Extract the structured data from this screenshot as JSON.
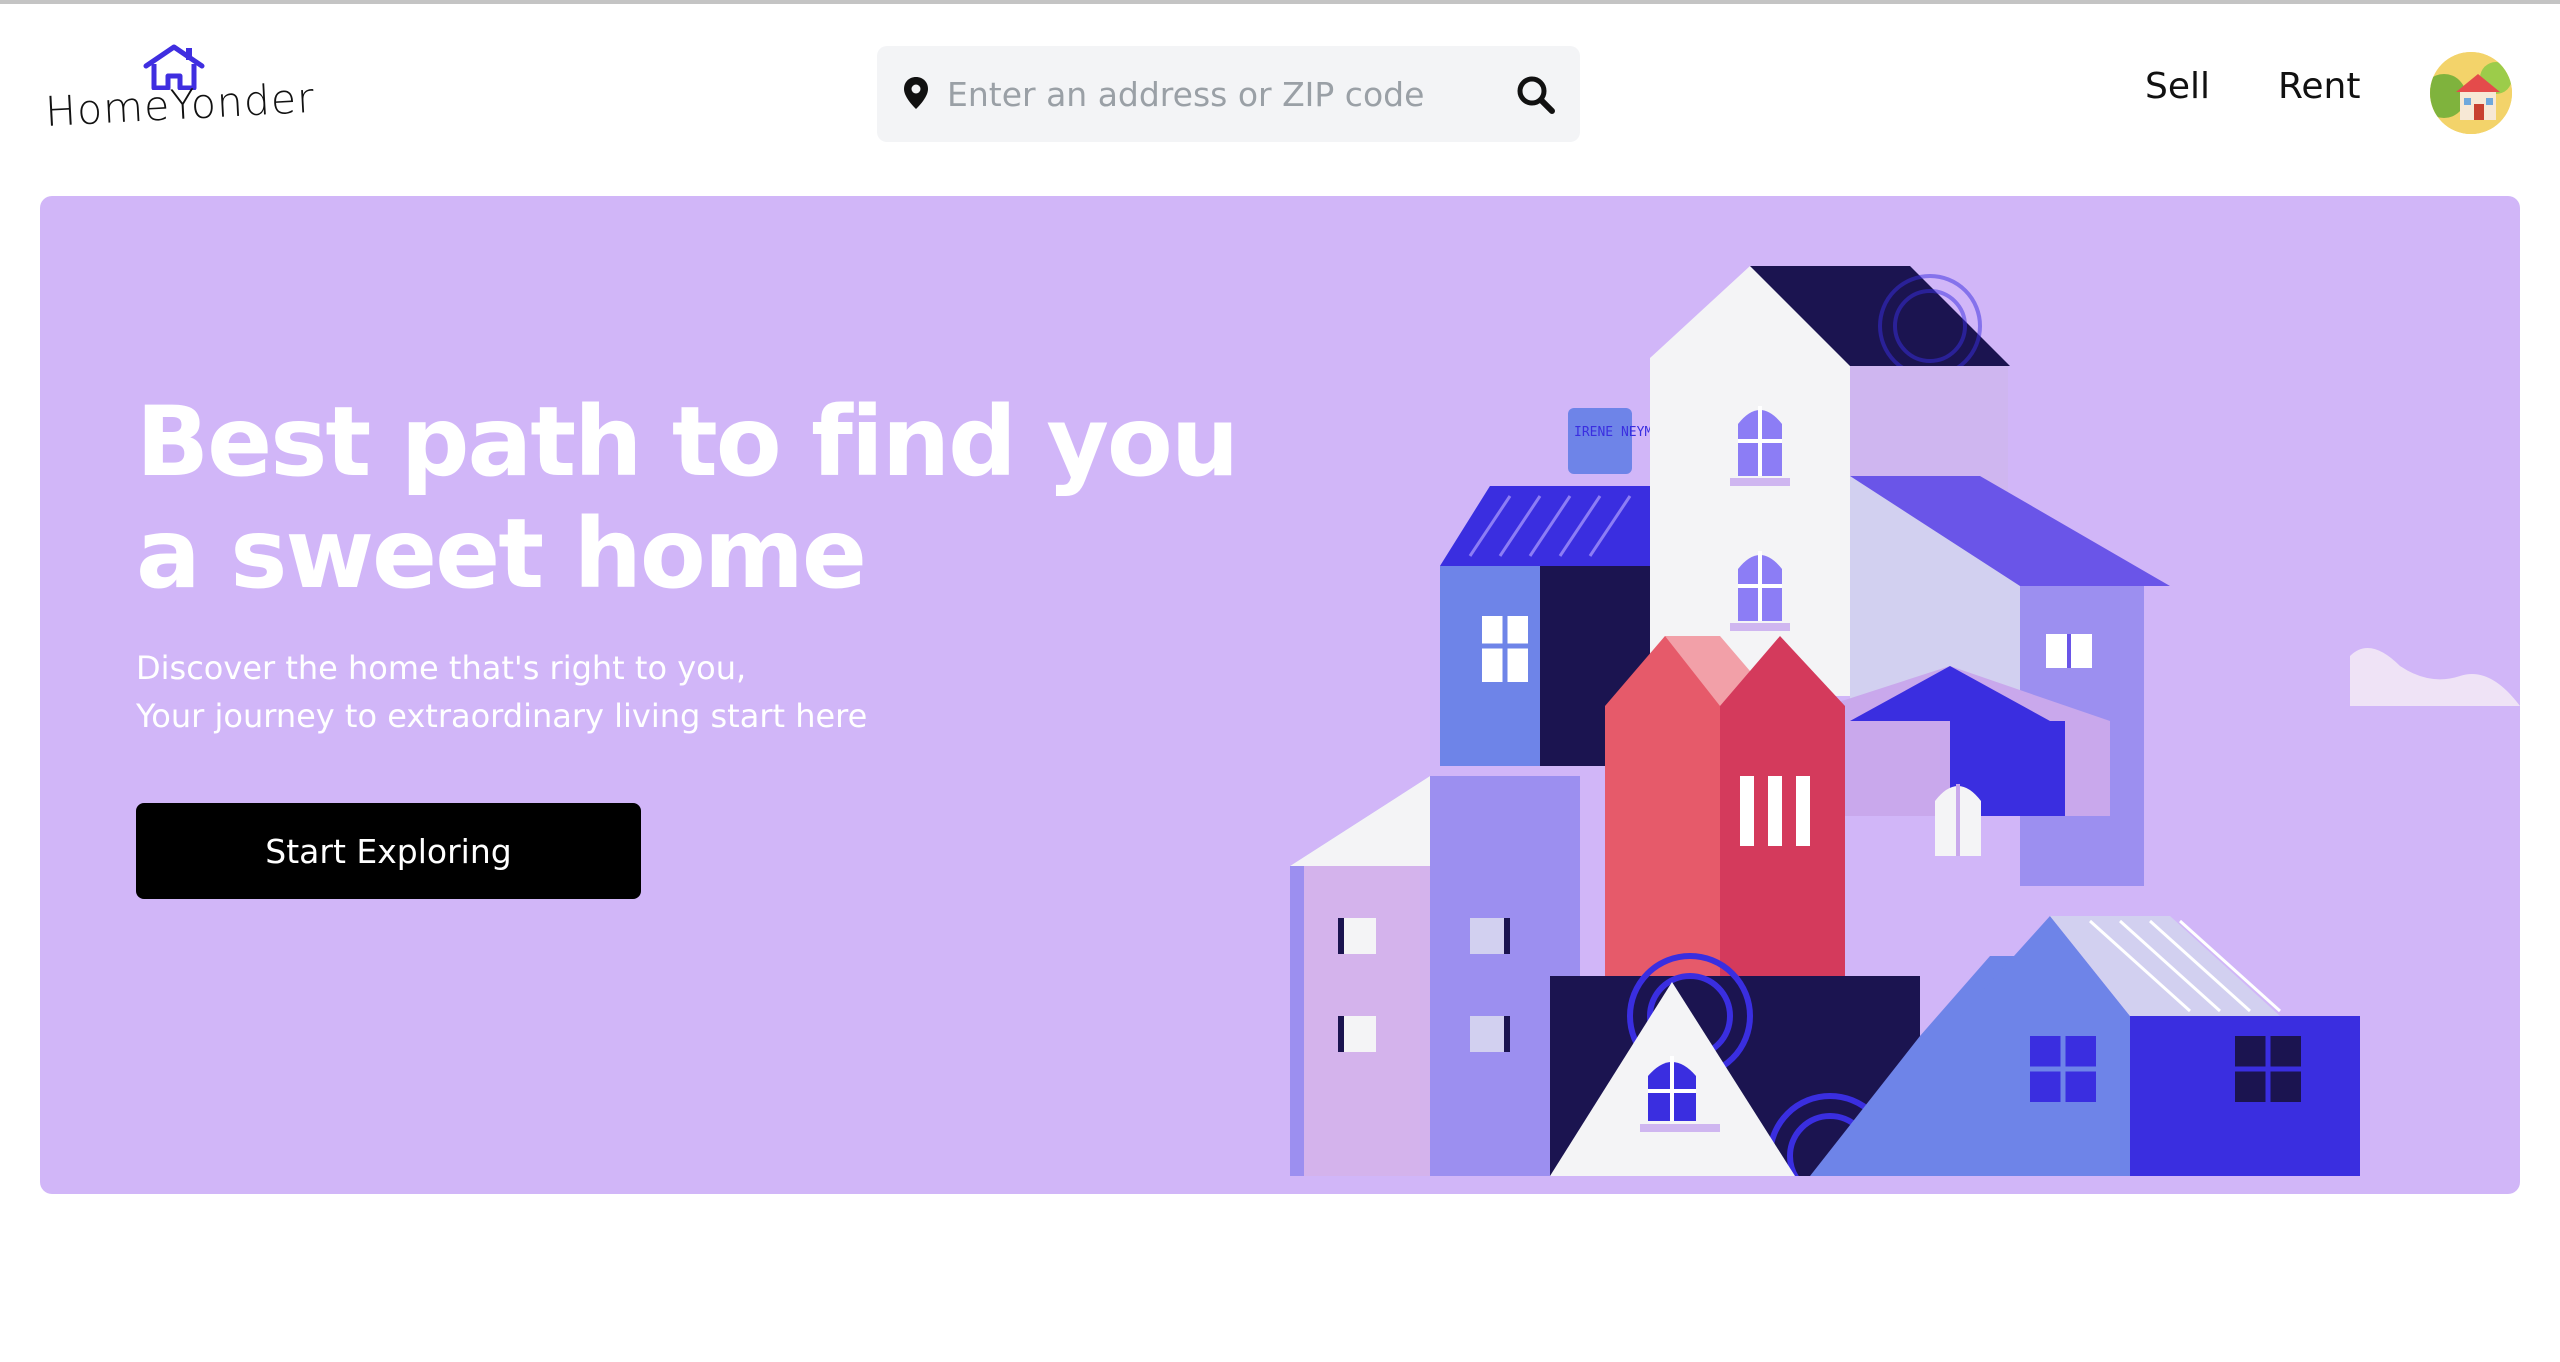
{
  "header": {
    "logo_text": "HomeYonder",
    "search": {
      "placeholder": "Enter an address or ZIP code",
      "value": ""
    },
    "nav": {
      "sell_label": "Sell",
      "rent_label": "Rent"
    }
  },
  "hero": {
    "title_line1": "Best path to find you",
    "title_line2": "a sweet home",
    "subtitle_line1": "Discover the home that's right to you,",
    "subtitle_line2": "Your journey to extraordinary living start here",
    "cta_label": "Start Exploring",
    "illustration_signature": "IRENE NEYMAN"
  },
  "colors": {
    "hero_bg": "#d1b6f8",
    "brand_blue": "#3f2ee0",
    "cta_bg": "#000000",
    "search_bg": "#f3f4f6"
  },
  "icons": {
    "logo": "house-icon",
    "search_left": "location-pin-icon",
    "search_right": "search-icon",
    "avatar": "house-avatar-icon"
  }
}
